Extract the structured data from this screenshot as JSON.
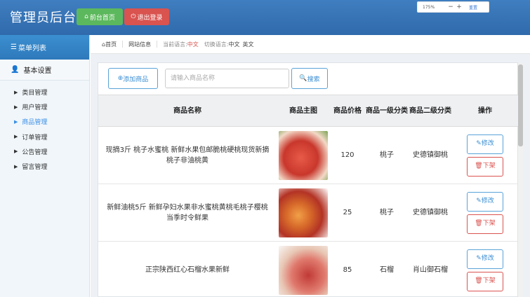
{
  "header": {
    "title": "管理员后台",
    "home_button": "前台首页",
    "logout_button": "退出登录"
  },
  "zoom_widget": {
    "value": "175%",
    "minus": "−",
    "plus": "+",
    "reset": "重置"
  },
  "sidebar": {
    "title": "菜单列表",
    "section": "基本设置",
    "items": [
      {
        "label": "类目管理"
      },
      {
        "label": "用户管理"
      },
      {
        "label": "商品管理"
      },
      {
        "label": "订单管理"
      },
      {
        "label": "公告管理"
      },
      {
        "label": "留言管理"
      }
    ],
    "active_item": "商品管理"
  },
  "breadcrumb": {
    "home": "首页",
    "site_info": "网站信息",
    "current_lang_label": "当前语言:",
    "current_lang": "中文",
    "switch_lang_label": "切换语言:",
    "lang_zh": "中文",
    "lang_en": "英文"
  },
  "toolbar": {
    "add_button": "添加商品",
    "search_placeholder": "请输入商品名称",
    "search_button": "搜索"
  },
  "table": {
    "headers": [
      "商品名称",
      "商品主图",
      "商品价格",
      "商品一级分类",
      "商品二级分类",
      "操作"
    ],
    "edit_label": "修改",
    "delete_label": "下架",
    "rows": [
      {
        "name": "现摘3斤 桃子水蜜桃 新鲜水果包邮脆桃硬桃现货新摘桃子非油桃黄",
        "price": "120",
        "cat1": "桃子",
        "cat2": "史德镇御桃"
      },
      {
        "name": "新鲜油桃5斤 新鲜孕妇水果非水蜜桃黄桃毛桃子樱桃当季时令鲜果",
        "price": "25",
        "cat1": "桃子",
        "cat2": "史德镇御桃"
      },
      {
        "name": "正宗陕西红心石榴水果新鲜",
        "price": "85",
        "cat1": "石榴",
        "cat2": "肖山御石榴"
      }
    ]
  }
}
